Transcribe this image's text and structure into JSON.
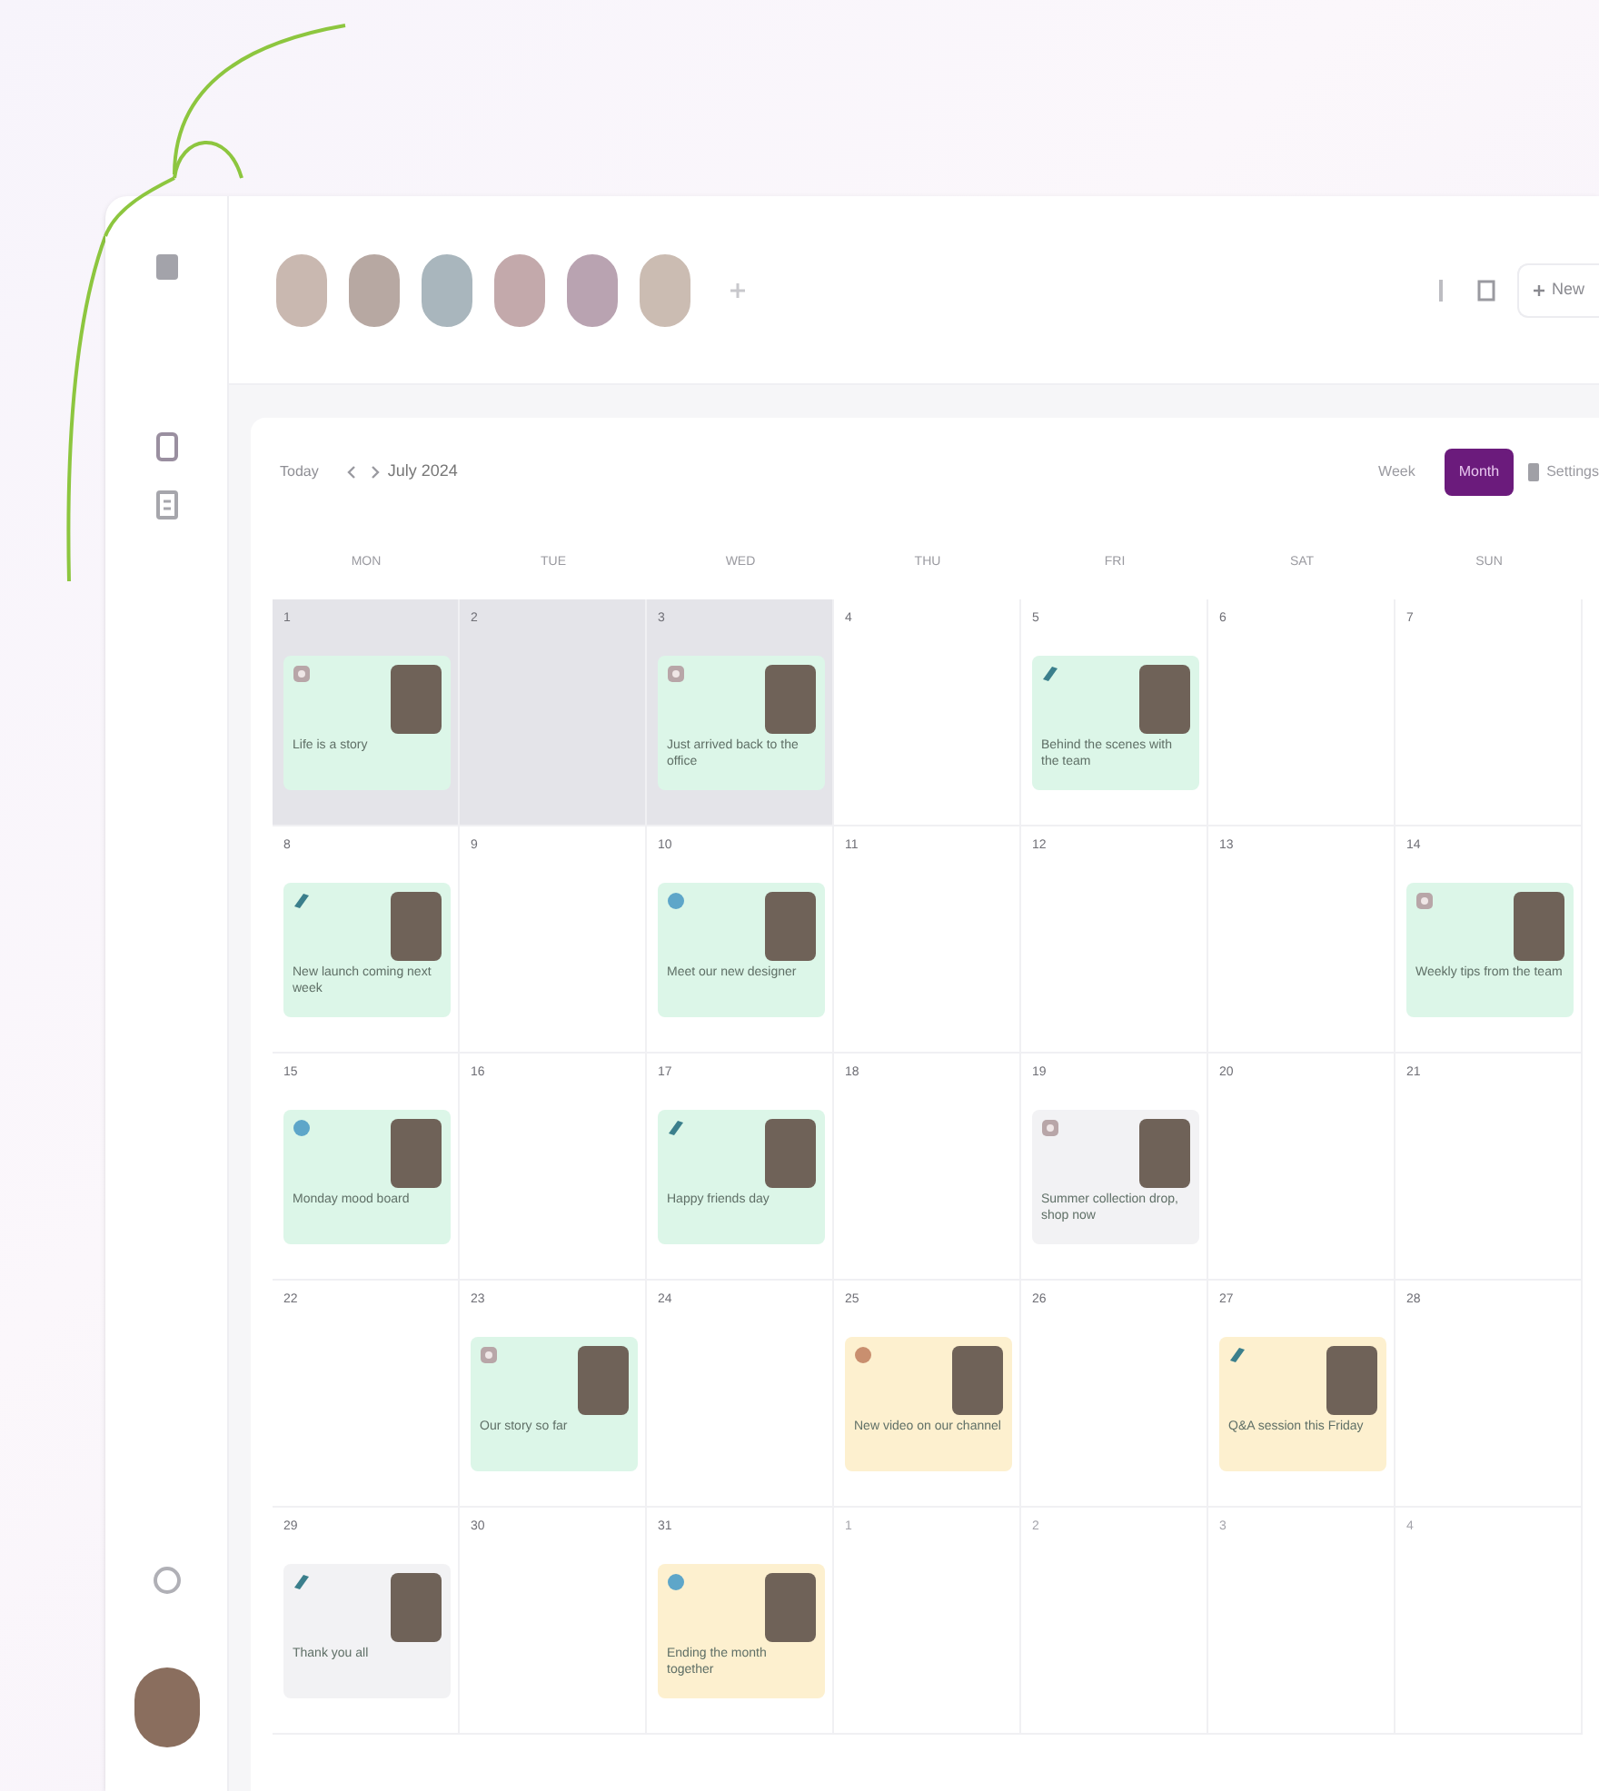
{
  "header": {
    "new_button": "New"
  },
  "toolbar": {
    "today": "Today",
    "month_label": "July 2024",
    "views": [
      {
        "label": "Week",
        "selected": false
      },
      {
        "label": "Month",
        "selected": true
      }
    ],
    "settings": "Settings"
  },
  "weekdays": [
    "MON",
    "TUE",
    "WED",
    "THU",
    "FRI",
    "SAT",
    "SUN"
  ],
  "days": [
    {
      "number": "1",
      "in_month": true,
      "selected": true,
      "event": {
        "kind": "instagram",
        "color": "#dcf6e8",
        "title": "Life is a story"
      }
    },
    {
      "number": "2",
      "in_month": true,
      "selected": true
    },
    {
      "number": "3",
      "in_month": true,
      "selected": true,
      "event": {
        "kind": "instagram",
        "color": "#dcf6e8",
        "title": "Just arrived back to the office"
      }
    },
    {
      "number": "4",
      "in_month": true,
      "selected": false
    },
    {
      "number": "5",
      "in_month": true,
      "selected": false,
      "event": {
        "kind": "twitter",
        "color": "#dcf6e8",
        "title": "Behind the scenes with the team"
      }
    },
    {
      "number": "6",
      "in_month": true,
      "selected": false
    },
    {
      "number": "7",
      "in_month": true,
      "selected": false
    },
    {
      "number": "8",
      "in_month": true,
      "selected": false,
      "event": {
        "kind": "twitter",
        "color": "#dcf6e8",
        "title": "New launch coming next week"
      }
    },
    {
      "number": "9",
      "in_month": true,
      "selected": false
    },
    {
      "number": "10",
      "in_month": true,
      "selected": false,
      "event": {
        "kind": "facebook",
        "color": "#dcf6e8",
        "title": "Meet our new designer"
      }
    },
    {
      "number": "11",
      "in_month": true,
      "selected": false
    },
    {
      "number": "12",
      "in_month": true,
      "selected": false
    },
    {
      "number": "13",
      "in_month": true,
      "selected": false
    },
    {
      "number": "14",
      "in_month": true,
      "selected": false,
      "event": {
        "kind": "instagram",
        "color": "#dcf6e8",
        "title": "Weekly tips from the team"
      }
    },
    {
      "number": "15",
      "in_month": true,
      "selected": false,
      "event": {
        "kind": "facebook",
        "color": "#dcf6e8",
        "title": "Monday mood board"
      }
    },
    {
      "number": "16",
      "in_month": true,
      "selected": false
    },
    {
      "number": "17",
      "in_month": true,
      "selected": false,
      "event": {
        "kind": "twitter",
        "color": "#dcf6e8",
        "title": "Happy friends day"
      }
    },
    {
      "number": "18",
      "in_month": true,
      "selected": false
    },
    {
      "number": "19",
      "in_month": true,
      "selected": false,
      "event": {
        "kind": "instagram",
        "color": "#f2f2f4",
        "title": "Summer collection drop, shop now"
      }
    },
    {
      "number": "20",
      "in_month": true,
      "selected": false
    },
    {
      "number": "21",
      "in_month": true,
      "selected": false
    },
    {
      "number": "22",
      "in_month": true,
      "selected": false
    },
    {
      "number": "23",
      "in_month": true,
      "selected": false,
      "event": {
        "kind": "instagram",
        "color": "#dcf6e8",
        "title": "Our story so far"
      }
    },
    {
      "number": "24",
      "in_month": true,
      "selected": false
    },
    {
      "number": "25",
      "in_month": true,
      "selected": false,
      "event": {
        "kind": "tiktok",
        "color": "#fdf0cf",
        "title": "New video on our channel"
      }
    },
    {
      "number": "26",
      "in_month": true,
      "selected": false
    },
    {
      "number": "27",
      "in_month": true,
      "selected": false,
      "event": {
        "kind": "twitter",
        "color": "#fdf0cf",
        "title": "Q&A session this Friday"
      }
    },
    {
      "number": "28",
      "in_month": true,
      "selected": false
    },
    {
      "number": "29",
      "in_month": true,
      "selected": false,
      "event": {
        "kind": "twitter",
        "color": "#f2f2f4",
        "title": "Thank you all"
      }
    },
    {
      "number": "30",
      "in_month": true,
      "selected": false
    },
    {
      "number": "31",
      "in_month": true,
      "selected": false,
      "event": {
        "kind": "facebook",
        "color": "#fdf0cf",
        "title": "Ending the month together"
      }
    },
    {
      "number": "1",
      "in_month": false,
      "selected": false
    },
    {
      "number": "2",
      "in_month": false,
      "selected": false
    },
    {
      "number": "3",
      "in_month": false,
      "selected": false
    },
    {
      "number": "4",
      "in_month": false,
      "selected": false
    }
  ]
}
